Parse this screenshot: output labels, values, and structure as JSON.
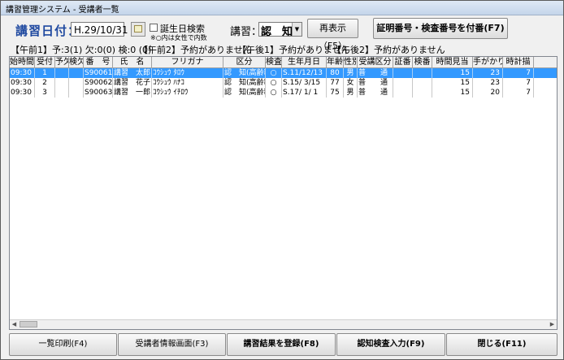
{
  "window": {
    "title": "講習管理システム - 受講者一覧"
  },
  "header": {
    "date_label": "講習日付：",
    "date_value": "H.29/10/31",
    "birthday_search_label": "誕生日検索",
    "birthday_note": "※○内は女性で内数",
    "course_label": "講習：",
    "course_value": "認　知",
    "redisplay_label": "再表示（F5）",
    "certificate_button_label": "証明番号・検査番号を付番(F7)"
  },
  "tabs": [
    "【午前1】予:3(1) 欠:0(0)  検:0 (0)",
    "【午前2】予約がありません",
    "【午後1】予約がありません",
    "【午後2】予約がありません"
  ],
  "table": {
    "columns": [
      "始時間",
      "受付",
      "予欠",
      "検欠",
      "番　号",
      "氏　名",
      "フリガナ",
      "区分",
      "検査",
      "生年月日",
      "年齢",
      "性別",
      "受講区分",
      "証番",
      "検番",
      "時間見当",
      "手がかり",
      "時計描"
    ],
    "rows": [
      [
        "09:30",
        "1",
        "",
        "",
        "S90061",
        "講習　太郎",
        "ｺｳｼｭｳ ﾀﾛｳ",
        "認　知(高齢新)",
        "○",
        "S.11/12/13",
        "80",
        "男",
        "普　　通",
        "",
        "",
        "15",
        "23",
        "7"
      ],
      [
        "09:30",
        "2",
        "",
        "",
        "S90062",
        "講習　花子",
        "ｺｳｼｭｳ ﾊﾅｺ",
        "認　知(高齢新)",
        "○",
        "S.15/ 3/15",
        "77",
        "女",
        "普　　通",
        "",
        "",
        "15",
        "23",
        "7"
      ],
      [
        "09:30",
        "3",
        "",
        "",
        "S90063",
        "講習　一郎",
        "ｺｳｼｭｳ ｲﾁﾛｳ",
        "認　知(高齢新)",
        "○",
        "S.17/ 1/ 1",
        "75",
        "男",
        "普　　通",
        "",
        "",
        "15",
        "20",
        "7"
      ]
    ]
  },
  "footer": {
    "print_list": "一覧印刷(F4)",
    "student_info": "受講者情報画面(F3)",
    "register_results": "講習結果を登録(F8)",
    "cognitive_input": "認知検査入力(F9)",
    "close": "閉じる(F11)"
  },
  "colors": {
    "selected_row": "#3399ff",
    "date_label": "#1f49a0"
  }
}
